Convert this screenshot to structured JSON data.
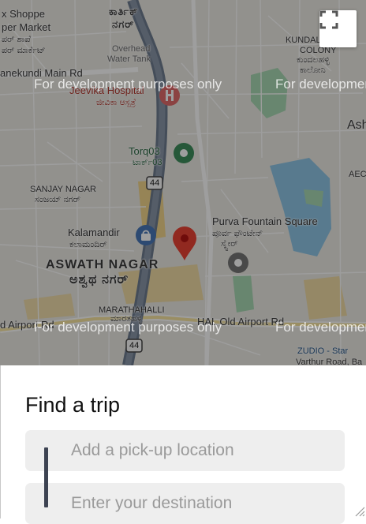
{
  "map": {
    "dev_watermark": "For development purposes only",
    "fullscreen_icon": "fullscreen-icon",
    "labels": {
      "shoppe_1": "x Shoppe",
      "shoppe_2": "per Market",
      "shoppe_kn_1": "ಪರ್ ಶಾಪೆ",
      "shoppe_kn_2": "ಪರ್ ಮಾರ್ಕೆಟ್",
      "kartik_kn": "ಕಾರ್ತಿಕ್",
      "nagar_kn": "ನಗರ್",
      "overhead_1": "Overhead",
      "overhead_2": "Water Tank",
      "main_rd": "anekundi Main Rd",
      "kundalahalli_1": "KUNDALAHALLI",
      "kundalahalli_2": "COLONY",
      "kundalahalli_kn_1": "ಕುಂದಲಹಳ್ಳಿ",
      "kundalahalli_kn_2": "ಕಾಲೋನಿ",
      "jeevika": "Jeevika Hospital",
      "jeevika_kn": "ಜೀವಿಕಾ ಆಸ್ಪತ್ರೆ",
      "ash": "Ash",
      "torq": "Torq03",
      "torq_kn": "ಟಾರ್ಕ್03",
      "aec": "AEC",
      "sanjay": "SANJAY NAGAR",
      "sanjay_kn": "ಸಂಜಯ್ ನಗರ್",
      "shield_44": "44",
      "kalamandir": "Kalamandir",
      "kalamandir_kn": "ಕಲಾಮಂದಿರ್",
      "purva": "Purva Fountain Square",
      "purva_kn_1": "ಪೂರ್ವ ಫೌಂಟೇನ್",
      "purva_kn_2": "ಸ್ಕ್ವೇರ್",
      "aswath": "ASWATH NAGAR",
      "aswath_kn": "ಅಶ್ವಥ ನಗರ್",
      "marathahalli": "MARATHAHALLI",
      "marathahalli_kn": "ಮಾರತಹಳ್ಳಿ",
      "airport_rd_left": "d Airport Rd",
      "airport_rd_right": "HAL Old Airport Rd",
      "zudio": "ZUDIO - Star",
      "varthur": "Varthur Road, Ba"
    }
  },
  "trip": {
    "title": "Find a trip",
    "pickup_placeholder": "Add a pick-up location",
    "destination_placeholder": "Enter your destination"
  },
  "colors": {
    "pin": "#ea4335",
    "connector": "#3d4352",
    "field_bg": "#eeeeee"
  }
}
